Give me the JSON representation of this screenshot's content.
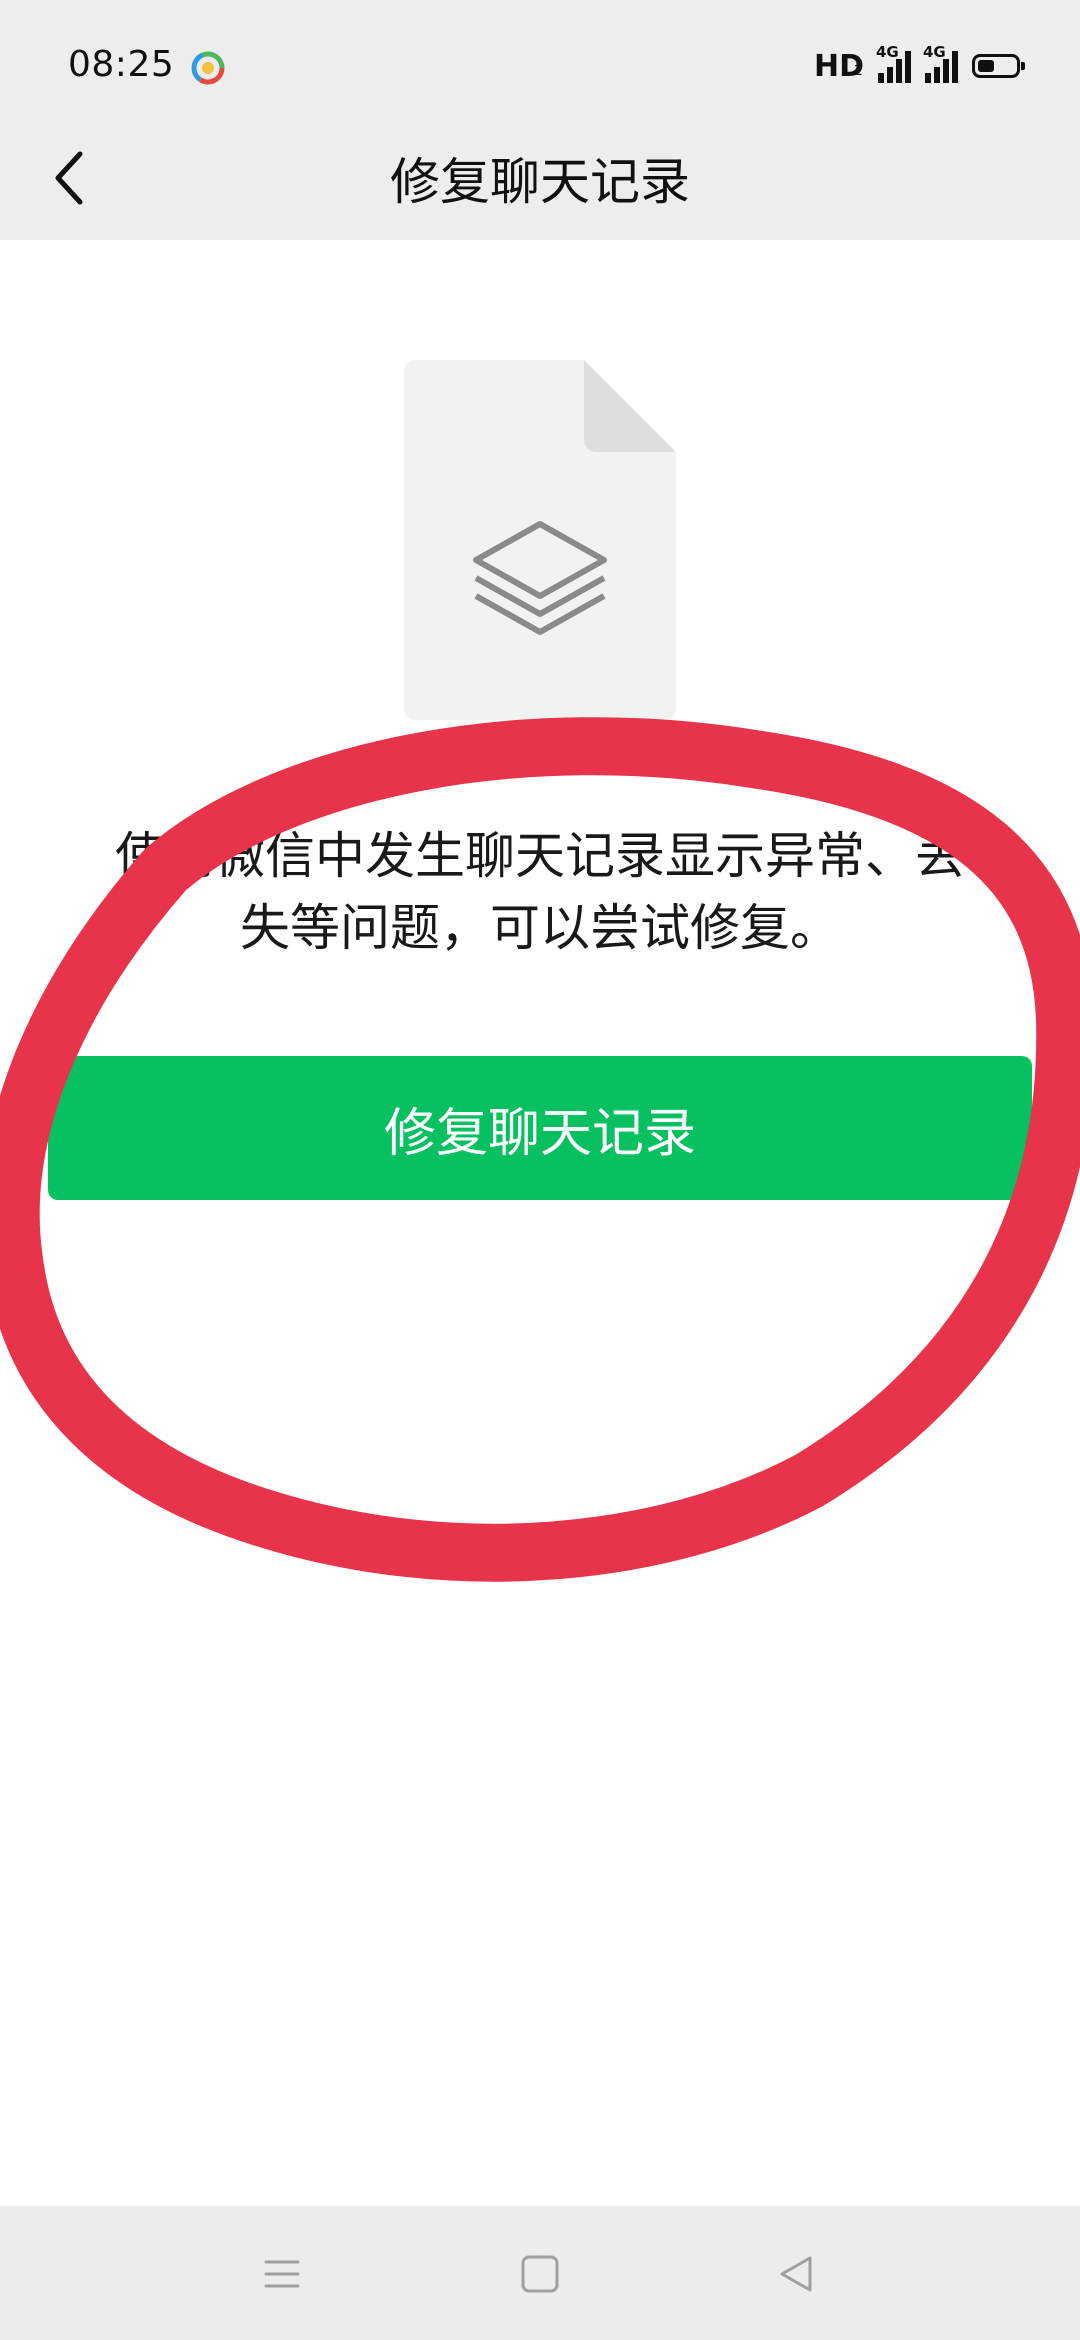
{
  "status_bar": {
    "time": "08:25",
    "hd_label": "HD",
    "hd_sub": "2",
    "network_1": "4G",
    "network_2": "4G",
    "app_icon": "colorful-ring-app-icon",
    "battery_icon": "battery-icon"
  },
  "header": {
    "title": "修复聊天记录",
    "back_icon": "chevron-left-icon"
  },
  "illustration": {
    "icon": "layers-document-icon"
  },
  "description": {
    "line1": "使用微信中发生聊天记录显示异常、丢",
    "line2": "失等问题，可以尝试修复。"
  },
  "primary_button": {
    "label": "修复聊天记录",
    "color": "#07c160"
  },
  "annotation": {
    "color": "#e8344a"
  },
  "nav_bar": {
    "menu_icon": "menu-icon",
    "home_icon": "home-square-icon",
    "back_icon": "back-triangle-icon"
  }
}
